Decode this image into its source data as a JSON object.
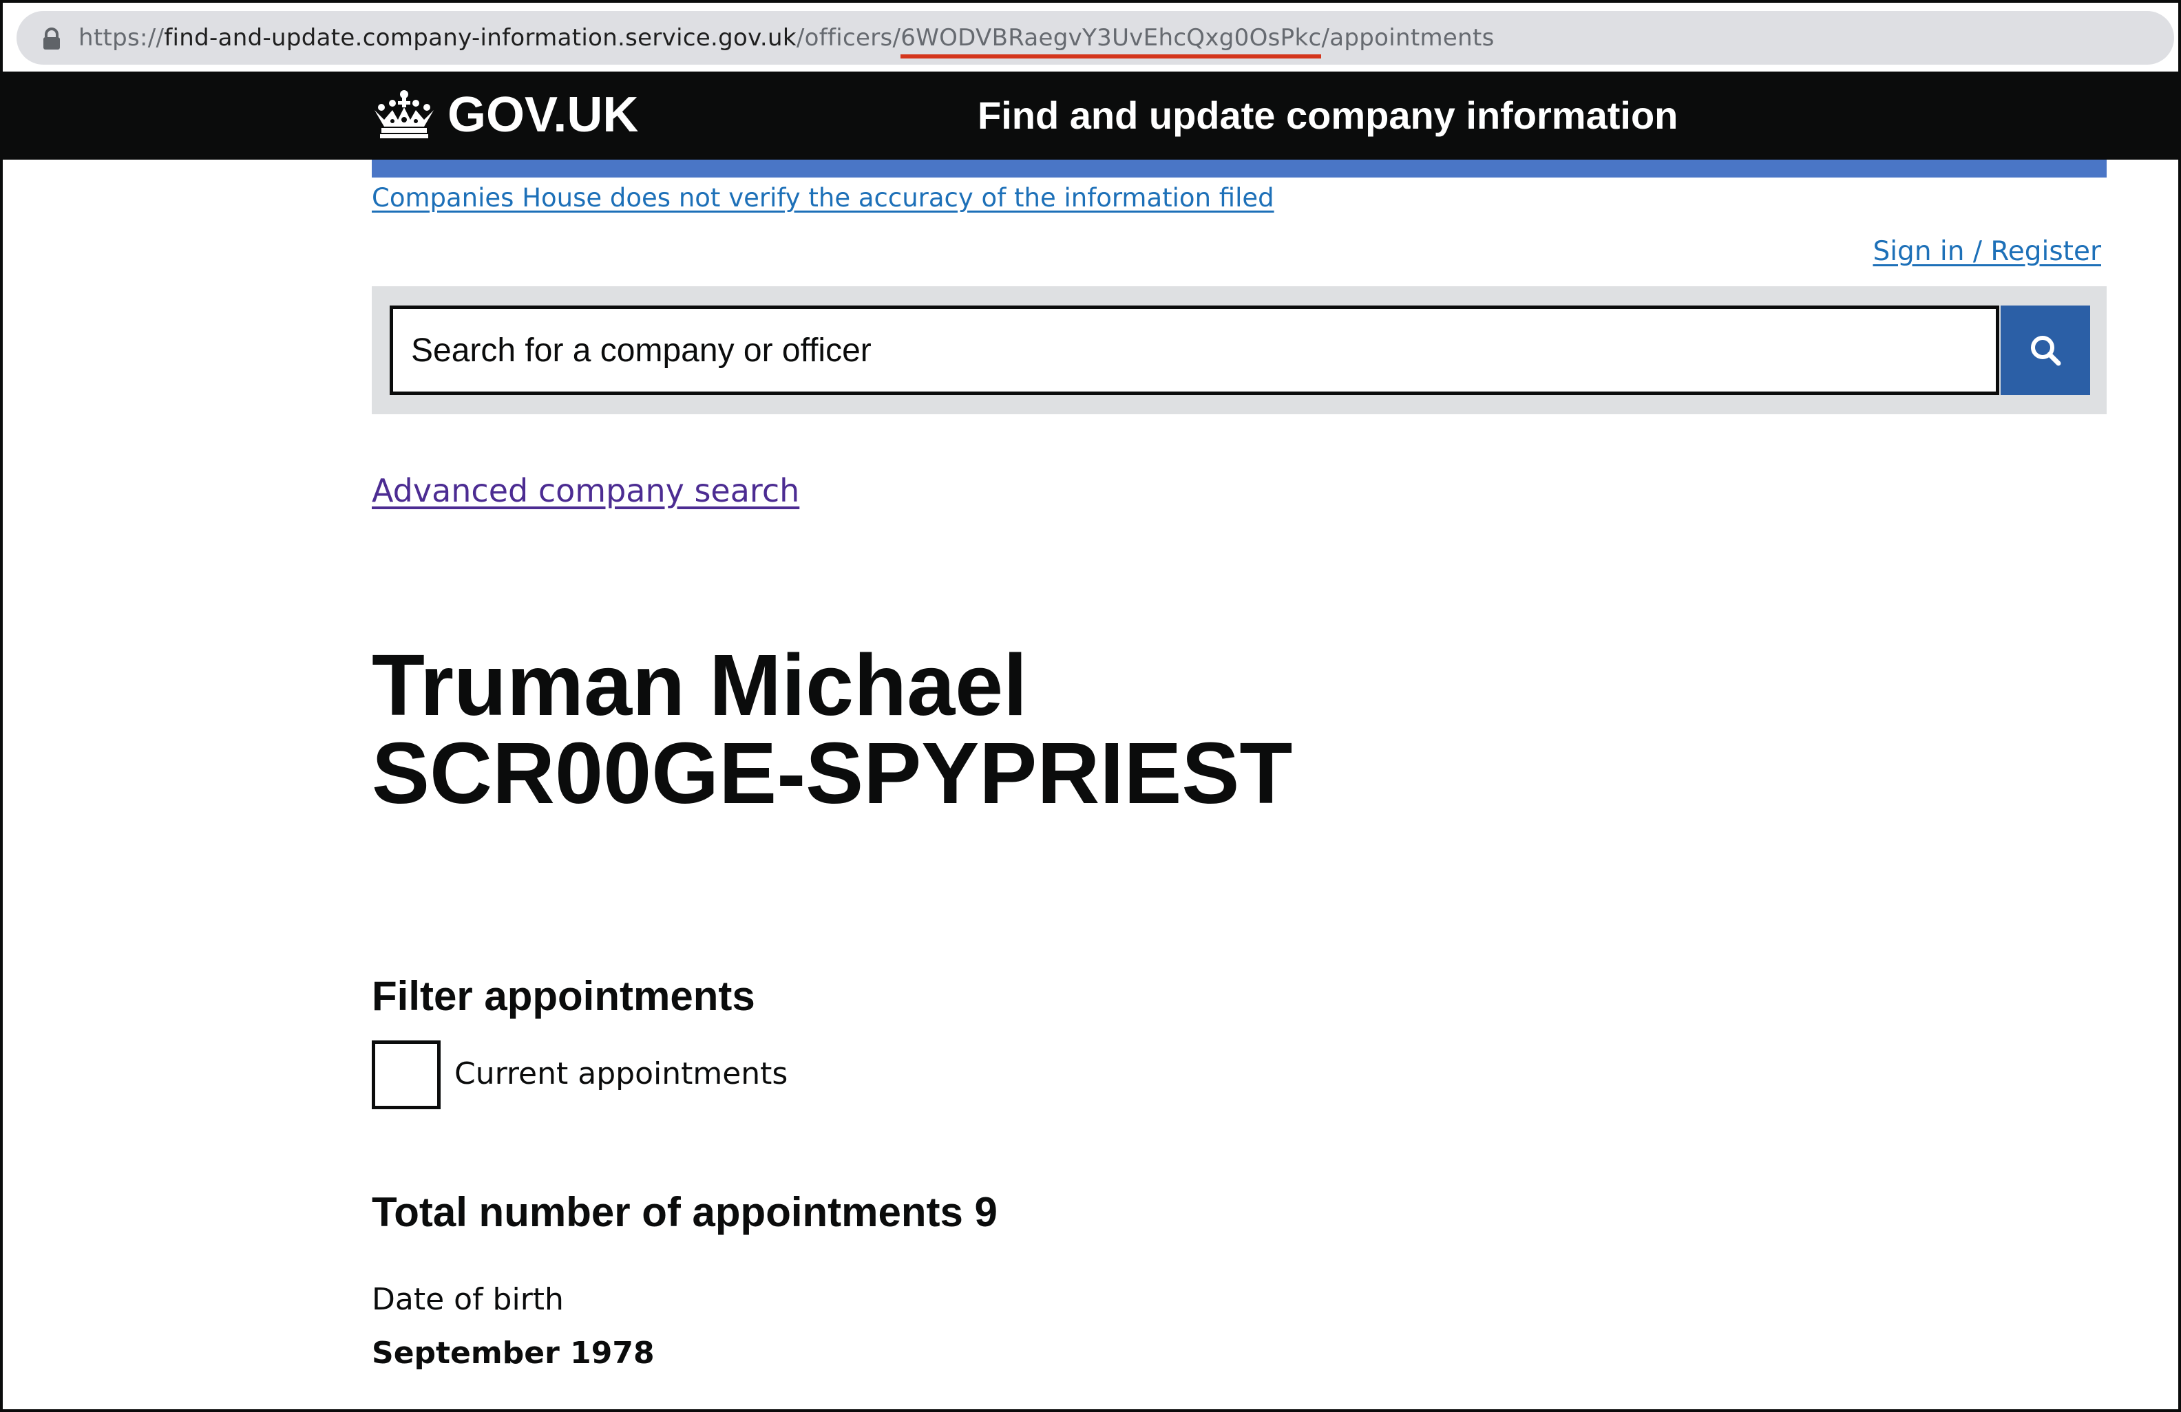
{
  "browser": {
    "url_scheme": "https://",
    "url_host": "find-and-update.company-information.service.gov.uk",
    "url_path_prefix": "/officers/",
    "url_officer_id": "6WODVBRaegvY3UvEhcQxg0OsPkc",
    "url_path_suffix": "/appointments",
    "lock_icon": "lock-icon"
  },
  "header": {
    "logo_icon": "crown-icon",
    "logotype": "GOV.UK",
    "service_name": "Find and update company information"
  },
  "notices": {
    "disclaimer": "Companies House does not verify the accuracy of the information filed"
  },
  "account": {
    "sign_in_label": "Sign in / Register"
  },
  "search": {
    "placeholder": "Search for a company or officer",
    "button_icon": "search-icon",
    "advanced_label": "Advanced company search"
  },
  "officer": {
    "name_line_1": "Truman Michael",
    "name_line_2": "SCR00GE-SPYPRIEST"
  },
  "filter": {
    "heading": "Filter appointments",
    "checkbox_label": "Current appointments",
    "checked": false
  },
  "appointments": {
    "total_label": "Total number of appointments 9"
  },
  "details": {
    "dob_label": "Date of birth",
    "dob_value": "September 1978"
  },
  "colors": {
    "header_bg": "#0b0c0c",
    "blue_bar": "#4a76c6",
    "link": "#1d70b8",
    "visited_link": "#4c2c92",
    "search_button": "#2b5fa6",
    "url_highlight_underline": "#d4351c"
  }
}
